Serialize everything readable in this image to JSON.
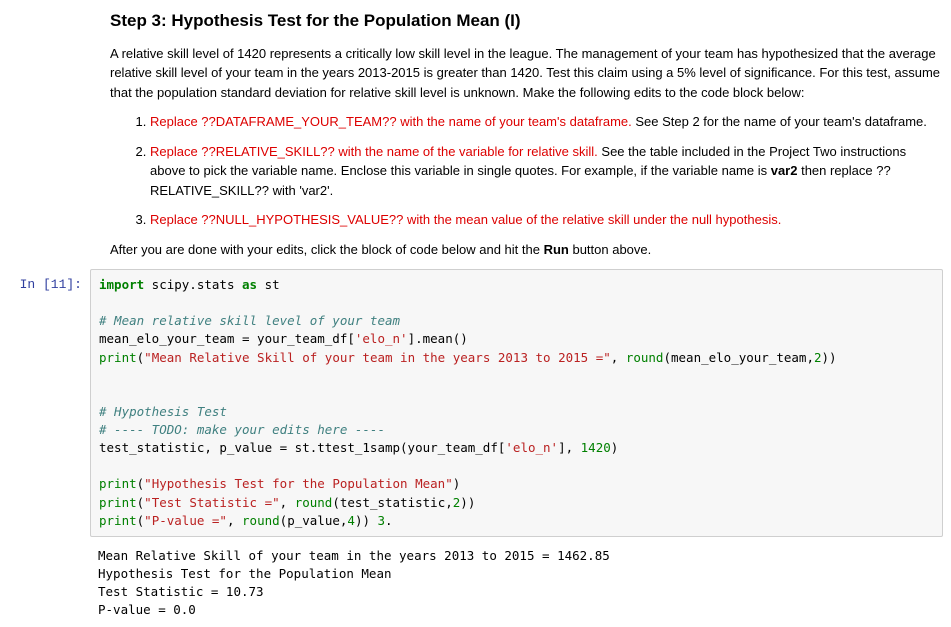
{
  "step": {
    "heading": "Step 3: Hypothesis Test for the Population Mean (I)",
    "intro": "A relative skill level of 1420 represents a critically low skill level in the league. The management of your team has hypothesized that the average relative skill level of your team in the years 2013-2015 is greater than 1420. Test this claim using a 5% level of significance. For this test, assume that the population standard deviation for relative skill level is unknown. Make the following edits to the code block below:",
    "items": [
      {
        "replace": "Replace ??DATAFRAME_YOUR_TEAM?? with the name of your team's dataframe.",
        "rest": " See Step 2 for the name of your team's dataframe."
      },
      {
        "replace": "Replace ??RELATIVE_SKILL?? with the name of the variable for relative skill.",
        "rest": " See the table included in the Project Two instructions above to pick the variable name. Enclose this variable in single quotes. For example, if the variable name is ",
        "bold": "var2",
        "rest2": " then replace ??RELATIVE_SKILL?? with 'var2'."
      },
      {
        "replace": "Replace ??NULL_HYPOTHESIS_VALUE?? with the mean value of the relative skill under the null hypothesis.",
        "rest": ""
      }
    ],
    "closing_pre": "After you are done with your edits, click the block of code below and hit the ",
    "closing_bold": "Run",
    "closing_post": " button above."
  },
  "cell": {
    "prompt": "In [11]:",
    "code": {
      "line1_import": "import",
      "line1_mod": " scipy.stats ",
      "line1_as": "as",
      "line1_alias": " st",
      "blank1": "",
      "comment1": "# Mean relative skill level of your team",
      "line2": "mean_elo_your_team = your_team_df[",
      "line2_str": "'elo_n'",
      "line2_end": "].mean()",
      "line3_print": "print",
      "line3_open": "(",
      "line3_str": "\"Mean Relative Skill of your team in the years 2013 to 2015 =\"",
      "line3_mid": ", ",
      "line3_round": "round",
      "line3_args": "(mean_elo_your_team,",
      "line3_num": "2",
      "line3_close": "))",
      "blank2": "",
      "blank3": "",
      "comment2": "# Hypothesis Test",
      "comment3": "# ---- TODO: make your edits here ----",
      "line4": "test_statistic, p_value = st.ttest_1samp(your_team_df[",
      "line4_str": "'elo_n'",
      "line4_mid": "], ",
      "line4_num": "1420",
      "line4_close": ")",
      "blank4": "",
      "line5_print": "print",
      "line5_open": "(",
      "line5_str": "\"Hypothesis Test for the Population Mean\"",
      "line5_close": ")",
      "line6_print": "print",
      "line6_open": "(",
      "line6_str": "\"Test Statistic =\"",
      "line6_mid": ", ",
      "line6_round": "round",
      "line6_args": "(test_statistic,",
      "line6_num": "2",
      "line6_close": "))",
      "line7_print": "print",
      "line7_open": "(",
      "line7_str": "\"P-value =\"",
      "line7_mid": ", ",
      "line7_round": "round",
      "line7_args": "(p_value,",
      "line7_num": "4",
      "line7_close": ")) ",
      "line7_trail": "3",
      "line7_dot": "."
    },
    "output": "Mean Relative Skill of your team in the years 2013 to 2015 = 1462.85\nHypothesis Test for the Population Mean\nTest Statistic = 10.73\nP-value = 0.0"
  }
}
